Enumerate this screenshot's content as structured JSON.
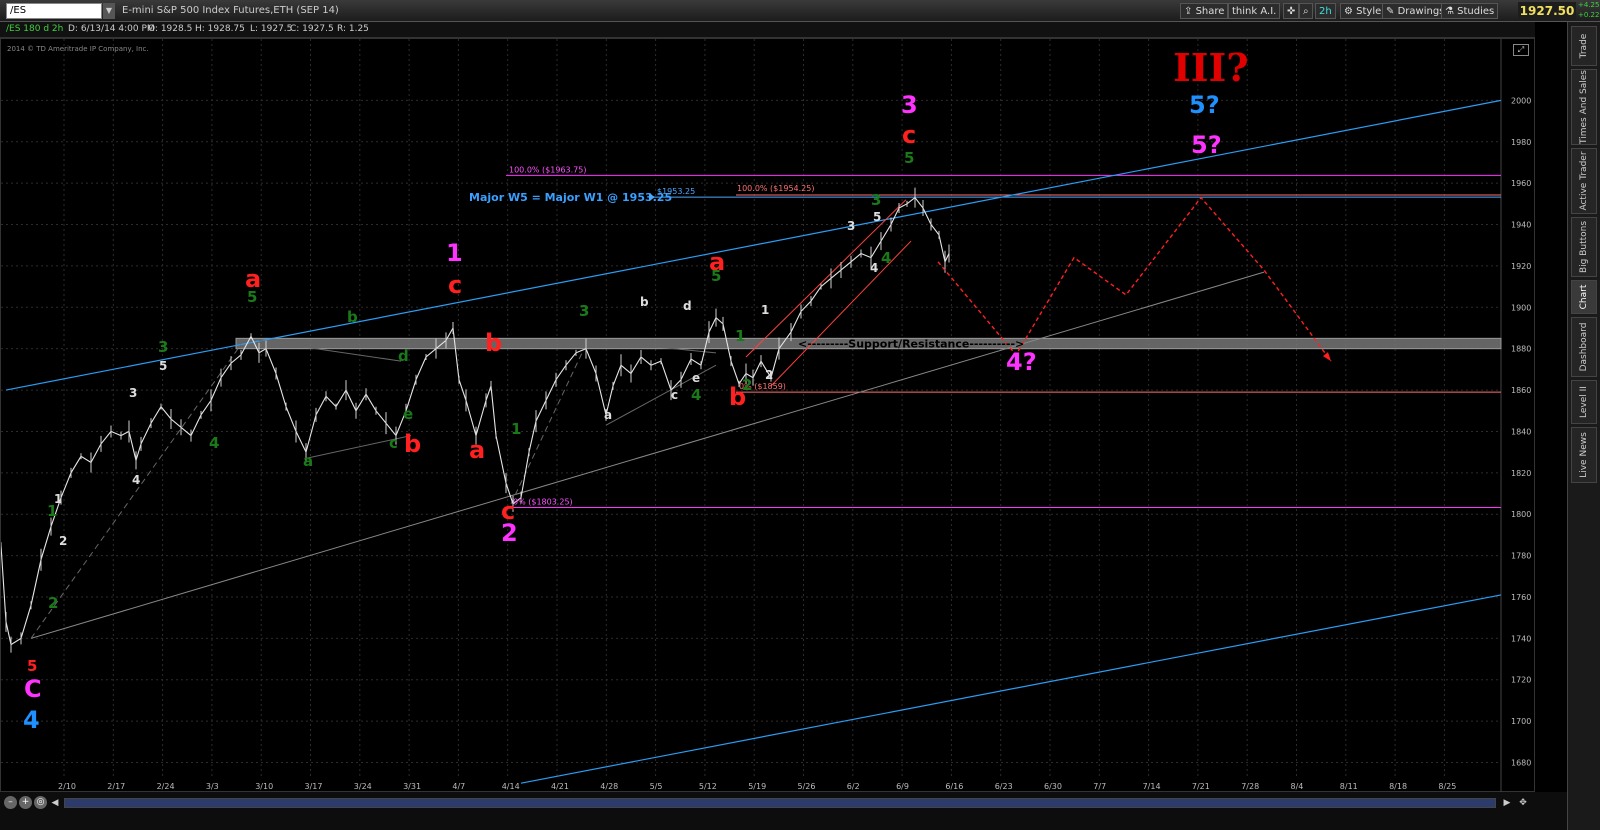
{
  "toolbar": {
    "symbol": "/ES",
    "description": "E-mini S&P 500 Index Futures,ETH (SEP 14)",
    "share": "Share",
    "think": "think A.I.",
    "aggregation": "2h",
    "style": "Style",
    "drawings": "Drawings",
    "studies": "Studies",
    "last_price": "1927.50",
    "change": "+4.25",
    "change_pct": "+0.22%"
  },
  "infobar": {
    "chart_symbol": "/ES 180 d 2h",
    "date": "D: 6/13/14 4:00 PM",
    "open": "O: 1928.5",
    "high": "H: 1928.75",
    "low": "L: 1927.5",
    "close": "C: 1927.5",
    "range": "R: 1.25"
  },
  "copyright": "2014 © TD Ameritrade IP Company, Inc.",
  "side_tabs": [
    "Trade",
    "Times And Sales",
    "Active Trader",
    "Big Buttons",
    "Chart",
    "Dashboard",
    "Level II",
    "Live News"
  ],
  "chart_data": {
    "type": "line",
    "y_ticks": [
      "2000",
      "1980",
      "1960",
      "1940",
      "1920",
      "1900",
      "1880",
      "1860",
      "1840",
      "1820",
      "1800",
      "1780",
      "1760",
      "1740",
      "1720",
      "1700",
      "1680"
    ],
    "x_ticks": [
      "2/10",
      "2/17",
      "2/24",
      "3/3",
      "3/10",
      "3/17",
      "3/24",
      "3/31",
      "4/7",
      "4/14",
      "4/21",
      "4/28",
      "5/5",
      "5/12",
      "5/19",
      "5/26",
      "6/2",
      "6/9",
      "6/16",
      "6/23",
      "6/30",
      "7/7",
      "7/14",
      "7/21",
      "7/28",
      "8/4",
      "8/11",
      "8/18",
      "8/25"
    ],
    "ylim": [
      1673,
      2020
    ],
    "series": [
      {
        "points": [
          [
            0,
            1785
          ],
          [
            5,
            1748
          ],
          [
            10,
            1737
          ],
          [
            20,
            1740
          ],
          [
            30,
            1756
          ],
          [
            40,
            1778
          ],
          [
            50,
            1794
          ],
          [
            60,
            1808
          ],
          [
            70,
            1820
          ],
          [
            80,
            1828
          ],
          [
            90,
            1825
          ],
          [
            100,
            1834
          ],
          [
            110,
            1840
          ],
          [
            120,
            1838
          ],
          [
            128,
            1840
          ],
          [
            135,
            1826
          ],
          [
            140,
            1834
          ],
          [
            150,
            1844
          ],
          [
            160,
            1852
          ],
          [
            170,
            1846
          ],
          [
            180,
            1842
          ],
          [
            190,
            1838
          ],
          [
            200,
            1848
          ],
          [
            210,
            1855
          ],
          [
            220,
            1866
          ],
          [
            230,
            1873
          ],
          [
            240,
            1877
          ],
          [
            250,
            1886
          ],
          [
            258,
            1878
          ],
          [
            265,
            1880
          ],
          [
            275,
            1868
          ],
          [
            285,
            1852
          ],
          [
            295,
            1840
          ],
          [
            305,
            1830
          ],
          [
            315,
            1848
          ],
          [
            325,
            1857
          ],
          [
            335,
            1852
          ],
          [
            345,
            1860
          ],
          [
            355,
            1850
          ],
          [
            365,
            1858
          ],
          [
            375,
            1850
          ],
          [
            385,
            1844
          ],
          [
            395,
            1838
          ],
          [
            405,
            1850
          ],
          [
            415,
            1865
          ],
          [
            425,
            1876
          ],
          [
            435,
            1880
          ],
          [
            445,
            1884
          ],
          [
            452,
            1890
          ],
          [
            458,
            1865
          ],
          [
            465,
            1855
          ],
          [
            475,
            1838
          ],
          [
            485,
            1855
          ],
          [
            490,
            1862
          ],
          [
            495,
            1838
          ],
          [
            505,
            1815
          ],
          [
            512,
            1805
          ],
          [
            520,
            1808
          ],
          [
            528,
            1830
          ],
          [
            535,
            1845
          ],
          [
            545,
            1855
          ],
          [
            555,
            1865
          ],
          [
            565,
            1872
          ],
          [
            575,
            1878
          ],
          [
            585,
            1880
          ],
          [
            595,
            1868
          ],
          [
            605,
            1848
          ],
          [
            612,
            1862
          ],
          [
            620,
            1872
          ],
          [
            630,
            1868
          ],
          [
            640,
            1876
          ],
          [
            650,
            1872
          ],
          [
            660,
            1874
          ],
          [
            670,
            1860
          ],
          [
            680,
            1865
          ],
          [
            690,
            1875
          ],
          [
            700,
            1872
          ],
          [
            708,
            1888
          ],
          [
            715,
            1895
          ],
          [
            722,
            1892
          ],
          [
            730,
            1874
          ],
          [
            738,
            1863
          ],
          [
            745,
            1868
          ],
          [
            752,
            1866
          ],
          [
            760,
            1874
          ],
          [
            770,
            1866
          ],
          [
            778,
            1880
          ],
          [
            790,
            1888
          ],
          [
            800,
            1898
          ],
          [
            810,
            1903
          ],
          [
            820,
            1910
          ],
          [
            830,
            1914
          ],
          [
            840,
            1918
          ],
          [
            850,
            1922
          ],
          [
            860,
            1926
          ],
          [
            870,
            1924
          ],
          [
            880,
            1932
          ],
          [
            890,
            1940
          ],
          [
            898,
            1948
          ],
          [
            906,
            1950
          ],
          [
            914,
            1953
          ],
          [
            922,
            1948
          ],
          [
            930,
            1940
          ],
          [
            938,
            1935
          ],
          [
            944,
            1922
          ],
          [
            948,
            1926
          ]
        ]
      }
    ],
    "projection": [
      [
        937,
        1922
      ],
      [
        1015,
        1877
      ],
      [
        1073,
        1924
      ],
      [
        1125,
        1906
      ],
      [
        1200,
        1953
      ],
      [
        1263,
        1918
      ],
      [
        1330,
        1874
      ]
    ],
    "annotations": {
      "major_w5": "Major W5 = Major W1 @ 1953.25",
      "w5_price": "$1953.25",
      "fib_top": "100.0% ($1963.75)",
      "fib_mid": "100.0% ($1954.25)",
      "fib_low": "0% ($1803.25)",
      "fib_859": "0% ($1859)",
      "support": "<---------Support/Resistance---------->"
    },
    "wave_labels": [
      {
        "t": "5",
        "c": "#ff2020",
        "s": "md",
        "x": 26,
        "y": 655
      },
      {
        "t": "C",
        "c": "#ff33ff",
        "s": "lg",
        "x": 23,
        "y": 672
      },
      {
        "t": "4",
        "c": "#1e90ff",
        "s": "lg",
        "x": 22,
        "y": 703
      },
      {
        "t": "1",
        "c": "#1a7a1a",
        "s": "md",
        "x": 46,
        "y": 500
      },
      {
        "t": "1",
        "c": "#ddd",
        "s": "sm",
        "x": 53,
        "y": 490
      },
      {
        "t": "2",
        "c": "#ddd",
        "s": "sm",
        "x": 58,
        "y": 532
      },
      {
        "t": "2",
        "c": "#1a7a1a",
        "s": "md",
        "x": 47,
        "y": 592
      },
      {
        "t": "3",
        "c": "#ddd",
        "s": "sm",
        "x": 128,
        "y": 384
      },
      {
        "t": "4",
        "c": "#ddd",
        "s": "sm",
        "x": 131,
        "y": 471
      },
      {
        "t": "3",
        "c": "#1a7a1a",
        "s": "md",
        "x": 157,
        "y": 336
      },
      {
        "t": "5",
        "c": "#ddd",
        "s": "sm",
        "x": 158,
        "y": 357
      },
      {
        "t": "4",
        "c": "#1a7a1a",
        "s": "md",
        "x": 208,
        "y": 432
      },
      {
        "t": "a",
        "c": "#ff2020",
        "s": "lg",
        "x": 244,
        "y": 262
      },
      {
        "t": "5",
        "c": "#1a7a1a",
        "s": "md",
        "x": 246,
        "y": 286
      },
      {
        "t": "b",
        "c": "#1a7a1a",
        "s": "md",
        "x": 346,
        "y": 306
      },
      {
        "t": "a",
        "c": "#1a7a1a",
        "s": "md",
        "x": 302,
        "y": 450
      },
      {
        "t": "d",
        "c": "#1a7a1a",
        "s": "md",
        "x": 397,
        "y": 345
      },
      {
        "t": "e",
        "c": "#1a7a1a",
        "s": "md",
        "x": 402,
        "y": 403
      },
      {
        "t": "c",
        "c": "#1a7a1a",
        "s": "md",
        "x": 388,
        "y": 432
      },
      {
        "t": "b",
        "c": "#ff2020",
        "s": "lg",
        "x": 403,
        "y": 427
      },
      {
        "t": "1",
        "c": "#ff33ff",
        "s": "lg",
        "x": 445,
        "y": 236
      },
      {
        "t": "c",
        "c": "#ff2020",
        "s": "lg",
        "x": 447,
        "y": 268
      },
      {
        "t": "b",
        "c": "#ff2020",
        "s": "lg",
        "x": 484,
        "y": 326
      },
      {
        "t": "a",
        "c": "#ff2020",
        "s": "lg",
        "x": 468,
        "y": 433
      },
      {
        "t": "1",
        "c": "#1a7a1a",
        "s": "md",
        "x": 510,
        "y": 418
      },
      {
        "t": "c",
        "c": "#ff2020",
        "s": "lg",
        "x": 500,
        "y": 494
      },
      {
        "t": "2",
        "c": "#ff33ff",
        "s": "lg",
        "x": 500,
        "y": 516
      },
      {
        "t": "3",
        "c": "#1a7a1a",
        "s": "md",
        "x": 578,
        "y": 300
      },
      {
        "t": "a",
        "c": "#ddd",
        "s": "sm",
        "x": 603,
        "y": 406
      },
      {
        "t": "b",
        "c": "#ddd",
        "s": "sm",
        "x": 639,
        "y": 293
      },
      {
        "t": "c",
        "c": "#ddd",
        "s": "sm",
        "x": 670,
        "y": 386
      },
      {
        "t": "d",
        "c": "#ddd",
        "s": "sm",
        "x": 682,
        "y": 297
      },
      {
        "t": "e",
        "c": "#ddd",
        "s": "sm",
        "x": 691,
        "y": 369
      },
      {
        "t": "4",
        "c": "#1a7a1a",
        "s": "md",
        "x": 690,
        "y": 384
      },
      {
        "t": "a",
        "c": "#ff2020",
        "s": "lg",
        "x": 708,
        "y": 245
      },
      {
        "t": "5",
        "c": "#1a7a1a",
        "s": "md",
        "x": 710,
        "y": 265
      },
      {
        "t": "1",
        "c": "#ddd",
        "s": "sm",
        "x": 760,
        "y": 301
      },
      {
        "t": "1",
        "c": "#1a7a1a",
        "s": "md",
        "x": 734,
        "y": 325
      },
      {
        "t": "b",
        "c": "#ff2020",
        "s": "lg",
        "x": 728,
        "y": 380
      },
      {
        "t": "2",
        "c": "#1a7a1a",
        "s": "md",
        "x": 741,
        "y": 374
      },
      {
        "t": "2",
        "c": "#ddd",
        "s": "sm",
        "x": 764,
        "y": 366
      },
      {
        "t": "3",
        "c": "#ddd",
        "s": "sm",
        "x": 846,
        "y": 217
      },
      {
        "t": "3",
        "c": "#1a7a1a",
        "s": "md",
        "x": 870,
        "y": 189
      },
      {
        "t": "5",
        "c": "#ddd",
        "s": "sm",
        "x": 872,
        "y": 208
      },
      {
        "t": "4",
        "c": "#ddd",
        "s": "sm",
        "x": 869,
        "y": 259
      },
      {
        "t": "4",
        "c": "#1a7a1a",
        "s": "md",
        "x": 880,
        "y": 247
      },
      {
        "t": "5",
        "c": "#1a7a1a",
        "s": "md",
        "x": 903,
        "y": 147
      },
      {
        "t": "c",
        "c": "#ff2020",
        "s": "lg",
        "x": 901,
        "y": 118
      },
      {
        "t": "3",
        "c": "#ff33ff",
        "s": "lg",
        "x": 900,
        "y": 88
      },
      {
        "t": "4?",
        "c": "#ff33ff",
        "s": "lg",
        "x": 1005,
        "y": 345
      },
      {
        "t": "III?",
        "c": "#e00000",
        "s": "xl",
        "x": 1172,
        "y": 42
      },
      {
        "t": "5?",
        "c": "#1e90ff",
        "s": "lg",
        "x": 1188,
        "y": 88
      },
      {
        "t": "5?",
        "c": "#ff33ff",
        "s": "lg",
        "x": 1190,
        "y": 128
      }
    ]
  }
}
